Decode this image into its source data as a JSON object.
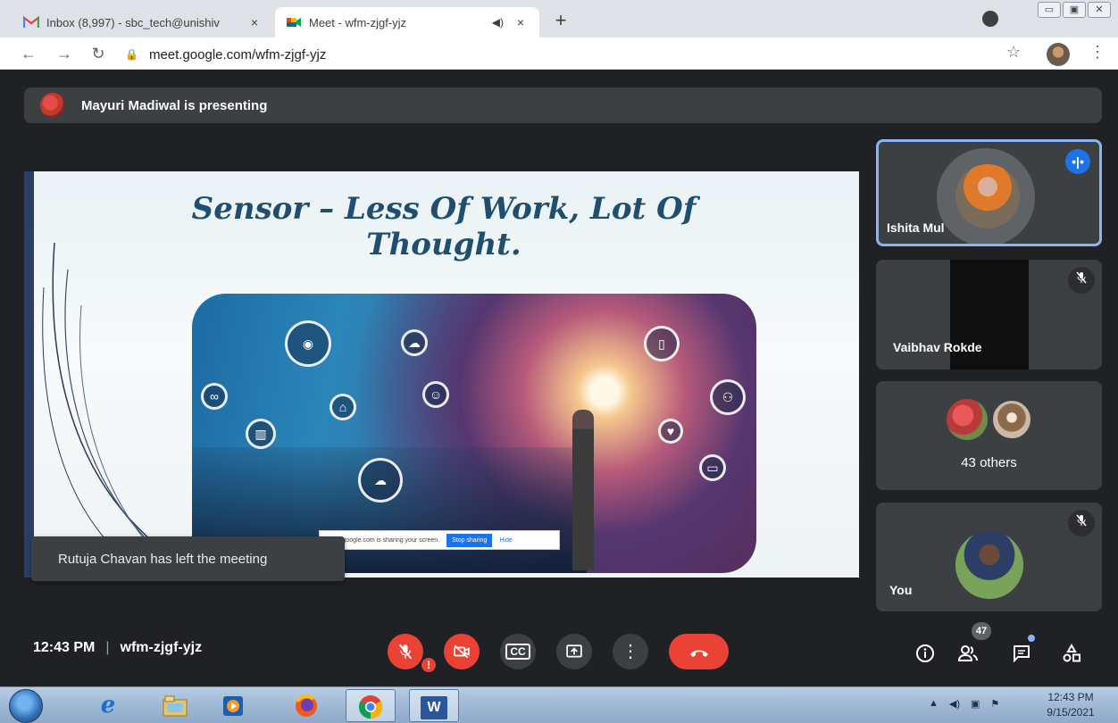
{
  "browser": {
    "tabs": [
      {
        "title": "Inbox (8,997) - sbc_tech@unishiv",
        "active": false
      },
      {
        "title": "Meet - wfm-zjgf-yjz",
        "active": true
      }
    ],
    "close_glyph": "×",
    "newtab_glyph": "+",
    "url": "meet.google.com/wfm-zjgf-yjz",
    "window_buttons": [
      "▭",
      "▣",
      "✕"
    ]
  },
  "meet": {
    "presenting_banner": "Mayuri Madiwal is presenting",
    "slide": {
      "title": "Sensor – Less Of Work, Lot Of Thought.",
      "share_notice": "meet.google.com is sharing your screen.",
      "stop_sharing": "Stop sharing",
      "hide": "Hide"
    },
    "toast": "Rutuja Chavan has left the meeting",
    "participants": [
      {
        "name": "Ishita Mul",
        "speaking": true
      },
      {
        "name": "Vaibhav Rokde",
        "muted": true
      },
      {
        "name": "43 others"
      },
      {
        "name": "You",
        "muted": true
      }
    ],
    "time": "12:43 PM",
    "separator": "|",
    "meeting_code": "wfm-zjgf-yjz",
    "people_count": "47",
    "icons": {
      "mic": "mic-off-icon",
      "camera": "camera-off-icon",
      "captions": "captions-icon",
      "present": "present-screen-icon",
      "more": "more-options-icon",
      "hangup": "hang-up-icon",
      "info": "info-icon",
      "people": "people-icon",
      "chat": "chat-icon",
      "activities": "activities-icon"
    },
    "colors": {
      "accent_blue": "#1a73e8",
      "danger_red": "#ea4335",
      "panel_grey": "#3c4043",
      "background": "#202124",
      "speaker_border": "#8ab4f8"
    }
  },
  "taskbar": {
    "clock_time": "12:43 PM",
    "clock_date": "9/15/2021",
    "word_label": "W"
  }
}
